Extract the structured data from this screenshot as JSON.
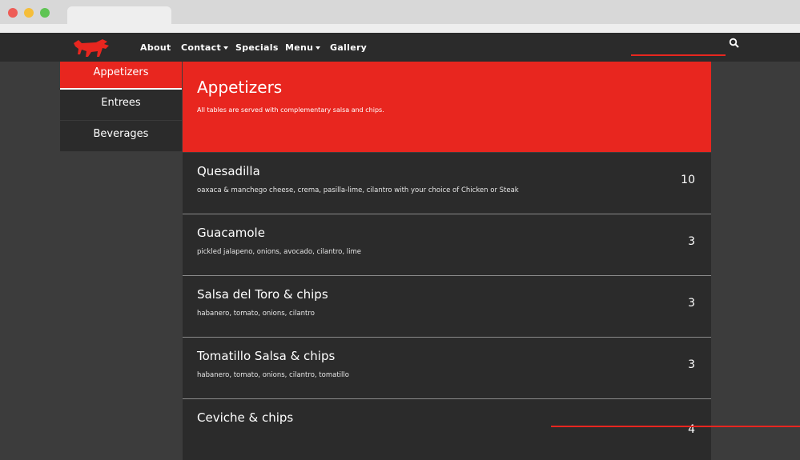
{
  "nav": {
    "items": [
      {
        "label": "About",
        "dropdown": false
      },
      {
        "label": "Contact",
        "dropdown": true
      },
      {
        "label": "Specials",
        "dropdown": false
      },
      {
        "label": "Menu",
        "dropdown": true
      },
      {
        "label": "Gallery",
        "dropdown": false
      }
    ],
    "search_icon": "search-icon",
    "logo_icon": "bull-logo-icon"
  },
  "sidebar": {
    "items": [
      {
        "label": "Appetizers",
        "active": true
      },
      {
        "label": "Entrees",
        "active": false
      },
      {
        "label": "Beverages",
        "active": false
      }
    ]
  },
  "section": {
    "title": "Appetizers",
    "subtitle": "All tables are served with complementary salsa and chips."
  },
  "menu_items": [
    {
      "name": "Quesadilla",
      "desc": "oaxaca & manchego cheese, crema, pasilla-lime, cilantro with your choice of Chicken or Steak",
      "price": "10"
    },
    {
      "name": "Guacamole",
      "desc": "pickled jalapeno, onions, avocado, cilantro, lime",
      "price": "3"
    },
    {
      "name": "Salsa del Toro & chips",
      "desc": "habanero, tomato, onions, cilantro",
      "price": "3"
    },
    {
      "name": "Tomatillo Salsa & chips",
      "desc": "habanero, tomato, onions, cilantro, tomatillo",
      "price": "3"
    },
    {
      "name": "Ceviche & chips",
      "desc": "",
      "price": "4"
    }
  ],
  "colors": {
    "accent": "#e8261f",
    "panel": "#2b2b2b",
    "background": "#3c3c3c"
  }
}
